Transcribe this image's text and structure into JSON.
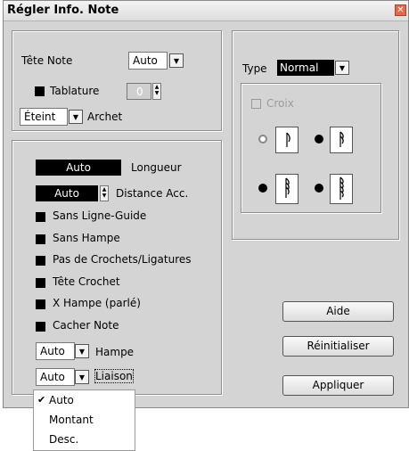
{
  "window": {
    "title": "Régler Info. Note",
    "close_glyph": "✕"
  },
  "notehead": {
    "label": "Tête Note",
    "value": "Auto",
    "tablature_label": "Tablature",
    "tablature_value": "0",
    "bow_value": "Éteint",
    "bow_label": "Archet"
  },
  "props": {
    "length_value": "Auto",
    "length_label": "Longueur",
    "acc_value": "Auto",
    "acc_label": "Distance Acc.",
    "checkboxes": [
      "Sans Ligne-Guide",
      "Sans Hampe",
      "Pas de Crochets/Ligatures",
      "Tête Crochet",
      "X Hampe (parlé)",
      "Cacher Note"
    ],
    "stem_value": "Auto",
    "stem_label": "Hampe",
    "tie_value": "Auto",
    "tie_label": "Liaison"
  },
  "type": {
    "label": "Type",
    "value": "Normal",
    "croix_label": "Croix"
  },
  "buttons": {
    "help": "Aide",
    "reset": "Réinitialiser",
    "apply": "Appliquer"
  },
  "dropdown_menu": {
    "items": [
      "Auto",
      "Montant",
      "Desc."
    ],
    "checked": "Auto",
    "check_glyph": "✔"
  },
  "icons": {
    "dropdown": "chevron-down-icon",
    "spin": "spin-arrows-icon"
  }
}
